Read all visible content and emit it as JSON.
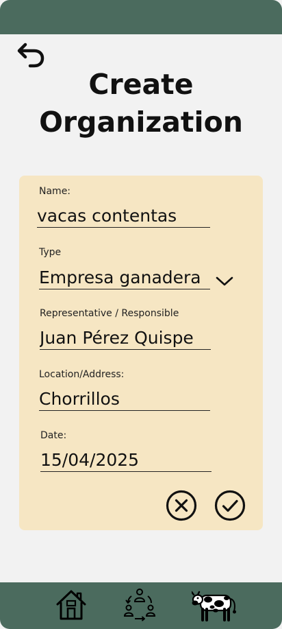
{
  "header": {
    "title_line1": "Create",
    "title_line2": "Organization"
  },
  "icons": {
    "back": "undo-arrow-icon",
    "dropdown": "chevron-down-icon",
    "cancel": "close-circle-icon",
    "confirm": "check-circle-icon",
    "home": "home-icon",
    "community": "people-network-icon",
    "cow": "cow-icon"
  },
  "form": {
    "name": {
      "label": "Name:",
      "value": "vacas contentas"
    },
    "type": {
      "label": "Type",
      "value": "Empresa ganadera"
    },
    "representative": {
      "label": "Representative / Responsible",
      "value": "Juan Pérez Quispe"
    },
    "location": {
      "label": "Location/Address:",
      "value": "Chorrillos"
    },
    "date": {
      "label": "Date:",
      "value": "15/04/2025"
    }
  },
  "colors": {
    "bar": "#4b6b5e",
    "card": "#f6e6c3",
    "background": "#f2f2f2"
  }
}
